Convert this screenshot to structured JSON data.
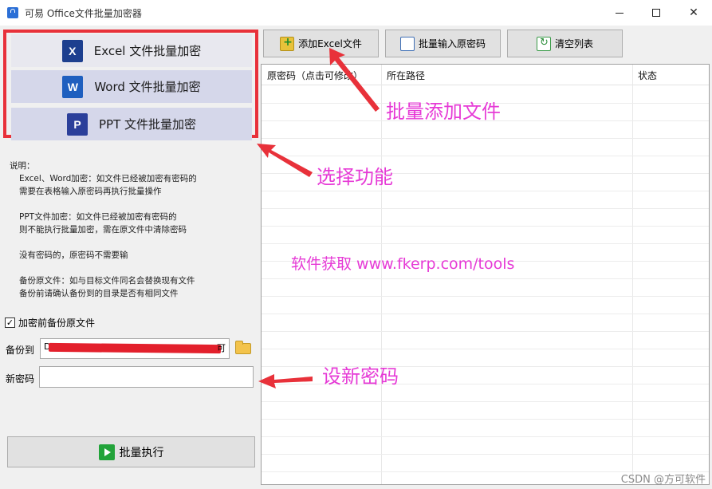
{
  "window": {
    "title": "可易 Office文件批量加密器",
    "minimize_icon": "minimize-icon",
    "maximize_icon": "maximize-icon",
    "close_icon": "close-icon"
  },
  "functions": [
    {
      "label": "Excel 文件批量加密",
      "icon": "excel-icon",
      "glyph": "X"
    },
    {
      "label": "Word 文件批量加密",
      "icon": "word-icon",
      "glyph": "W"
    },
    {
      "label": "PPT 文件批量加密",
      "icon": "ppt-icon",
      "glyph": "P"
    }
  ],
  "notes": {
    "heading": "说明：",
    "excel_word_1": "Excel、Word加密：如文件已经被加密有密码的",
    "excel_word_2": "需要在表格输入原密码再执行批量操作",
    "ppt_1": "PPT文件加密：如文件已经被加密有密码的",
    "ppt_2": "则不能执行批量加密，需在原文件中清除密码",
    "no_pwd": "没有密码的，原密码不需要输",
    "backup_1": "备份原文件：如与目标文件同名会替换现有文件",
    "backup_2": "备份前请确认备份到的目录是否有相同文件"
  },
  "backup": {
    "checkbox_label": "加密前备份原文件",
    "checked": true,
    "label": "备份到",
    "value_prefix": "D",
    "value_suffix": "可"
  },
  "password": {
    "label": "新密码",
    "value": ""
  },
  "execute": {
    "label": "批量执行"
  },
  "toolbar": {
    "add_excel": "添加Excel文件",
    "batch_input": "批量输入原密码",
    "clear_list": "清空列表"
  },
  "grid": {
    "columns": [
      "原密码（点击可修改）",
      "所在路径",
      "状态"
    ],
    "rows": []
  },
  "annotations": {
    "add_files": "批量添加文件",
    "select_function": "选择功能",
    "link": "软件获取 www.fkerp.com/tools",
    "set_password": "设新密码",
    "watermark": "CSDN @方可软件",
    "color": "#e63ad6",
    "arrow_color": "#e8313a"
  }
}
